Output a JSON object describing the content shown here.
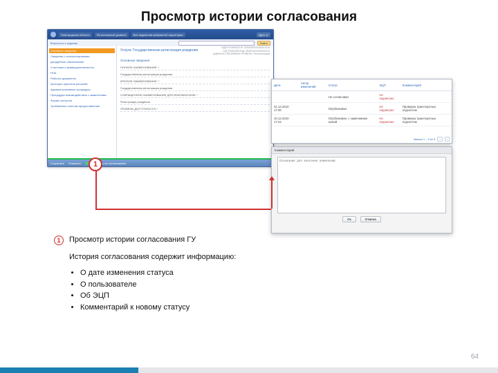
{
  "slide": {
    "title": "Просмотр истории согласования",
    "page_number": "64"
  },
  "app1": {
    "top": {
      "crumb1": "Новгородская область",
      "crumb2": "Региональный уровень",
      "crumb3": "Все ведомства выбранной территории",
      "user": "sgf s. s."
    },
    "sub": {
      "back": "Вернуться к задачам",
      "search_value": "",
      "search_button": "Найти"
    },
    "nav": [
      "Основные сведения",
      "Сведения о консультировании",
      "Досудебное обжалование",
      "Участники и межведомственность",
      "НПА",
      "Рабочие документы",
      "Критерии принятия решений",
      "Административные процедуры",
      "Процедуры взаимодействия с заявителями",
      "Формы контроля",
      "Требования к местам предоставления"
    ],
    "main": {
      "title": "Услуга: Государственная регистрация рождения",
      "meta_line1": "ИДЕНТИФИКАТОР: 5300000001000001915",
      "meta_line2": "СИСТЕМНЫЙ КОД: 053020011000000010",
      "meta_line3": "АДМИНИСТРАТИВНЫЙ УРОВЕНЬ: Региональный",
      "section": "Основные сведения",
      "f1": "ПОЛНОЕ НАИМЕНОВАНИЕ: *",
      "f2": "Государственная регистрация рождения",
      "f3": "КРАТКОЕ НАИМЕНОВАНИЕ: *",
      "f4": "Государственная регистрация рождения",
      "f5": "СОКРАЩЕННОЕ НАИМЕНОВАНИЕ ДЛЯ ИНФОКИОСКОВ: *",
      "f6": "Регистрация рождения",
      "f7": "УРОВЕНЬ ДОСТУПНОСТИ: *"
    },
    "footer": {
      "btn1": "Сохранить",
      "btn2": "Отменить",
      "btn3": "Отправить на согласование"
    }
  },
  "history": {
    "cols": {
      "date": "Дата",
      "author": "Автор изменений",
      "status": "Статус",
      "ecp": "ЭЦП",
      "comment": "Комментарий"
    },
    "rows": [
      {
        "date": "",
        "author": "",
        "status": "Не согласован",
        "ecp": "Не подписано",
        "comment": ""
      },
      {
        "date": "31.12.2010 17:00",
        "author": "",
        "status": "Опубликован",
        "ecp": "Не подписано",
        "comment": "Проверка транспортных подсистем"
      },
      {
        "date": "10.12.2010 17:22",
        "author": "",
        "status": "Опубликован, с замечанием новый",
        "ecp": "Не подписано",
        "comment": "Проверка транспортных подсистем"
      }
    ],
    "pager": {
      "info": "Записи 1 – 3 из 3",
      "prev": "‹",
      "next": "›"
    }
  },
  "dialog": {
    "title": "Комментарий",
    "placeholder": "Основание для внесения изменений",
    "ok": "Ок",
    "cancel": "Отмена"
  },
  "callout": {
    "num": "1"
  },
  "explain": {
    "lead": "Просмотр истории согласования ГУ",
    "intro": "История согласования содержит информацию:",
    "bullets": [
      "О дате изменения статуса",
      "О пользователе",
      "Об ЭЦП",
      "Комментарий к новому статусу"
    ]
  }
}
